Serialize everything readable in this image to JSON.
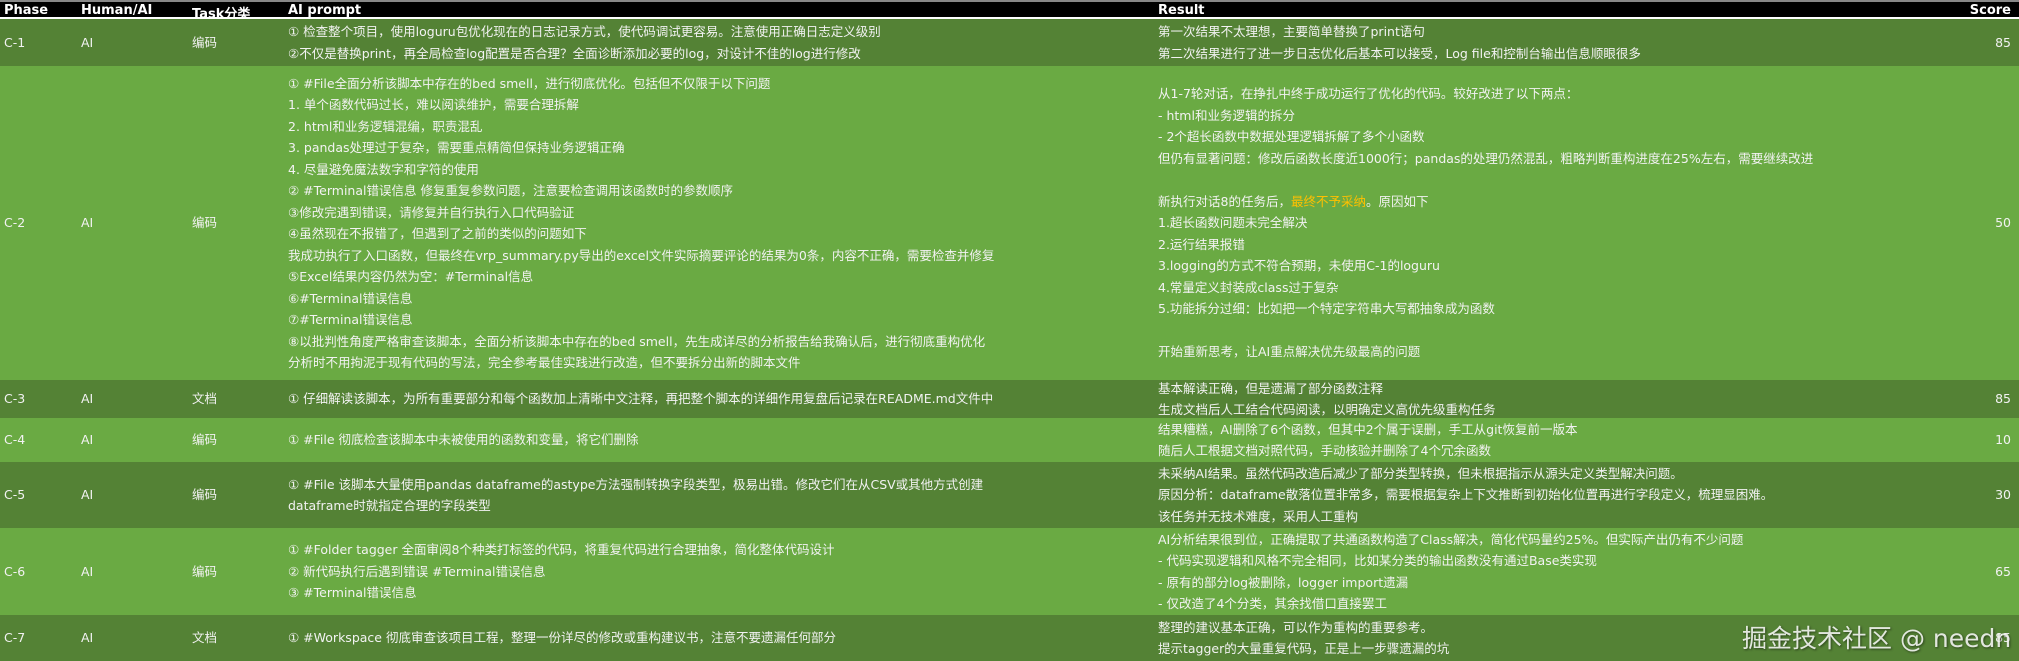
{
  "headers": {
    "phase": "Phase",
    "who": "Human/AI",
    "task": "Task分类",
    "prompt": "AI prompt",
    "result": "Result",
    "score": "Score"
  },
  "accent_colors": {
    "dark_row": "#548235",
    "light_row": "#6aaa43",
    "highlight": "#ffc000",
    "header": "#000000"
  },
  "rows": [
    {
      "phase": "C-1",
      "who": "AI",
      "task": "编码",
      "prompt": [
        "① 检查整个项目，使用loguru包优化现在的日志记录方式，使代码调试更容易。注意使用正确日志定义级别",
        "②不仅是替换print，再全局检查log配置是否合理？全面诊断添加必要的log，对设计不佳的log进行修改"
      ],
      "result": [
        "第一次结果不太理想，主要简单替换了print语句",
        "第二次结果进行了进一步日志优化后基本可以接受，Log file和控制台输出信息顺眼很多"
      ],
      "score": "85"
    },
    {
      "phase": "C-2",
      "who": "AI",
      "task": "编码",
      "prompt": [
        "① #File全面分析该脚本中存在的bed smell，进行彻底优化。包括但不仅限于以下问题",
        "1. 单个函数代码过长，难以阅读维护，需要合理拆解",
        "2. html和业务逻辑混编，职责混乱",
        "3. pandas处理过于复杂，需要重点精简但保持业务逻辑正确",
        "4. 尽量避免魔法数字和字符的使用",
        "② #Terminal错误信息 修复重复参数问题，注意要检查调用该函数时的参数顺序",
        "③修改完遇到错误，请修复并自行执行入口代码验证",
        "④虽然现在不报错了，但遇到了之前的类似的问题如下",
        " 我成功执行了入口函数，但最终在vrp_summary.py导出的excel文件实际摘要评论的结果为0条，内容不正确，需要检查并修复",
        "⑤Excel结果内容仍然为空：#Terminal信息",
        "⑥#Terminal错误信息",
        "⑦#Terminal错误信息",
        "⑧以批判性角度严格审查该脚本，全面分析该脚本中存在的bed smell，先生成详尽的分析报告给我确认后，进行彻底重构优化",
        "分析时不用拘泥于现有代码的写法，完全参考最佳实践进行改造，但不要拆分出新的脚本文件"
      ],
      "result": [
        "从1-7轮对话，在挣扎中终于成功运行了优化的代码。较好改进了以下两点：",
        "- html和业务逻辑的拆分",
        "- 2个超长函数中数据处理逻辑拆解了多个小函数",
        "但仍有显著问题：修改后函数长度近1000行；pandas的处理仍然混乱，粗略判断重构进度在25%左右，需要继续改进",
        ""
      ],
      "result_mid": {
        "before": "新执行对话8的任务后，",
        "highlight": "最终不予采纳",
        "after": "。原因如下"
      },
      "result_tail": [
        "1.超长函数问题未完全解决",
        "2.运行结果报错",
        "3.logging的方式不符合预期，未使用C-1的loguru",
        "4.常量定义封装成class过于复杂",
        "5.功能拆分过细：比如把一个特定字符串大写都抽象成为函数",
        "",
        "开始重新思考，让AI重点解决优先级最高的问题"
      ],
      "score": "50"
    },
    {
      "phase": "C-3",
      "who": "AI",
      "task": "文档",
      "prompt": [
        "① 仔细解读该脚本，为所有重要部分和每个函数加上清晰中文注释，再把整个脚本的详细作用复盘后记录在README.md文件中"
      ],
      "result": [
        "基本解读正确，但是遗漏了部分函数注释",
        "生成文档后人工结合代码阅读，以明确定义高优先级重构任务"
      ],
      "score": "85"
    },
    {
      "phase": "C-4",
      "who": "AI",
      "task": "编码",
      "prompt": [
        "① #File 彻底检查该脚本中未被使用的函数和变量，将它们删除"
      ],
      "result": [
        "结果糟糕，AI删除了6个函数，但其中2个属于误删，手工从git恢复前一版本",
        "随后人工根据文档对照代码，手动核验并删除了4个冗余函数"
      ],
      "score": "10"
    },
    {
      "phase": "C-5",
      "who": "AI",
      "task": "编码",
      "prompt": [
        "① #File 该脚本大量使用pandas dataframe的astype方法强制转换字段类型，极易出错。修改它们在从CSV或其他方式创建",
        "dataframe时就指定合理的字段类型"
      ],
      "result": [
        "未采纳AI结果。虽然代码改造后减少了部分类型转换，但未根据指示从源头定义类型解决问题。",
        "原因分析：dataframe散落位置非常多，需要根据复杂上下文推断到初始化位置再进行字段定义，梳理显困难。",
        "该任务并无技术难度，采用人工重构"
      ],
      "score": "30"
    },
    {
      "phase": "C-6",
      "who": "AI",
      "task": "编码",
      "prompt": [
        "①  #Folder tagger 全面审阅8个种类打标签的代码，将重复代码进行合理抽象，简化整体代码设计",
        "② 新代码执行后遇到错误 #Terminal错误信息",
        "③ #Terminal错误信息"
      ],
      "result": [
        "AI分析结果很到位，正确提取了共通函数构造了Class解决，简化代码量约25%。但实际产出仍有不少问题",
        "- 代码实现逻辑和风格不完全相同，比如某分类的输出函数没有通过Base类实现",
        "- 原有的部分log被删除，logger import遗漏",
        "- 仅改造了4个分类，其余找借口直接罢工"
      ],
      "score": "65"
    },
    {
      "phase": "C-7",
      "who": "AI",
      "task": "文档",
      "prompt": [
        "①  #Workspace 彻底审查该项目工程，整理一份详尽的修改或重构建议书，注意不要遗漏任何部分"
      ],
      "result": [
        "整理的建议基本正确，可以作为重构的重要参考。",
        "提示tagger的大量重复代码，正是上一步骤遗漏的坑"
      ],
      "score": "85"
    }
  ],
  "watermark": "掘金技术社区 @ needn"
}
